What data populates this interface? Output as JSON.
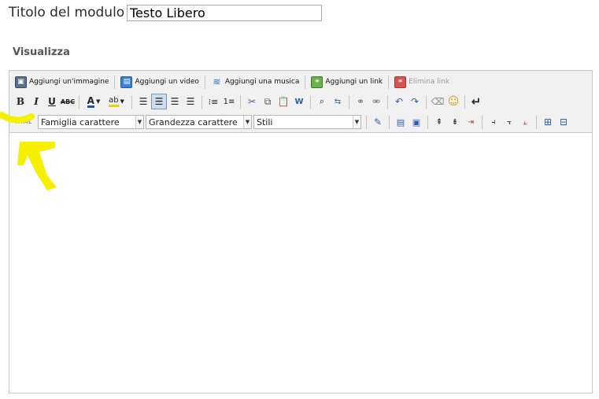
{
  "form": {
    "title_label": "Titolo del modulo",
    "title_value": "Testo Libero",
    "section_label": "Visualizza"
  },
  "toolbar": {
    "add_image": "Aggiungi un'immagine",
    "add_video": "Aggiungi un video",
    "add_music": "Aggiungi una musica",
    "add_link": "Aggiungi un link",
    "remove_link": "Elimina link",
    "bold": "B",
    "italic": "I",
    "underline": "U",
    "strikethrough": "ABC",
    "font_color_glyph": "A",
    "highlight_glyph": "ab",
    "html_button": "HTML",
    "font_family": "Famiglia carattere",
    "font_size": "Grandezza carattere",
    "styles": "Stili"
  },
  "annotation": {
    "color": "#f5ef00",
    "shape": "arrow pointing up at HTML button"
  }
}
